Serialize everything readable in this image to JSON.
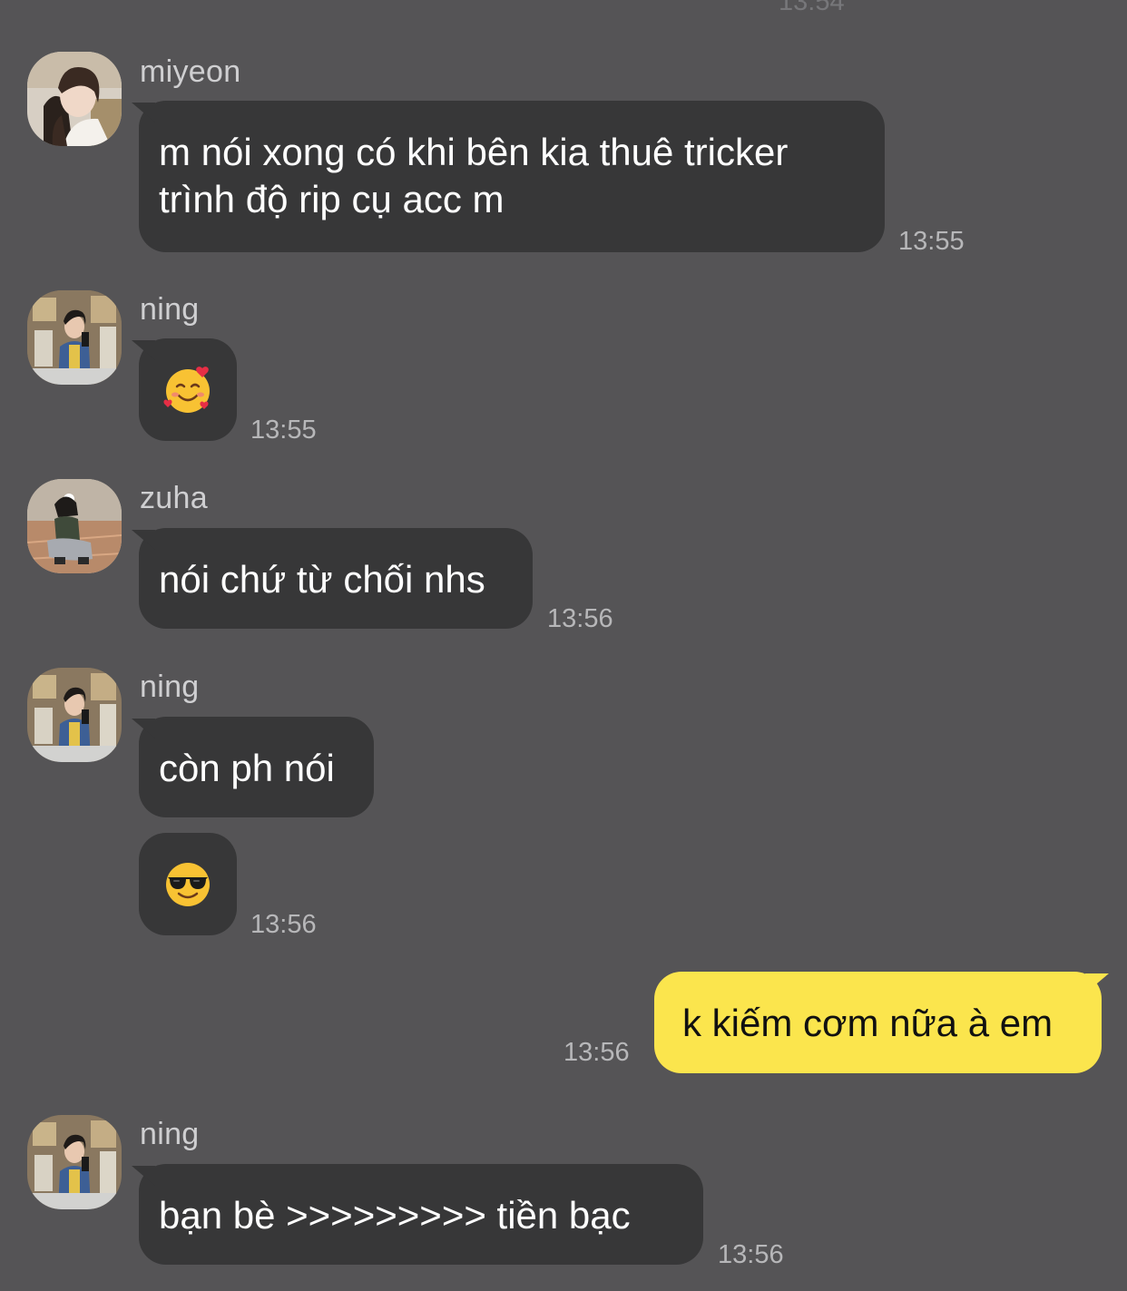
{
  "chat": {
    "top_timestamp": "13:54",
    "messages": [
      {
        "sender": "miyeon",
        "lines": [
          "m nói xong có khi bên kia thuê tricker",
          "trình độ rip cụ acc m"
        ],
        "time": "13:55"
      },
      {
        "sender": "ning",
        "emoji": "smiling-face-with-hearts",
        "time": "13:55"
      },
      {
        "sender": "zuha",
        "text": "nói chứ từ chối nhs",
        "time": "13:56"
      },
      {
        "sender": "ning",
        "text": "còn ph nói"
      },
      {
        "emoji": "smiling-face-with-sunglasses",
        "time": "13:56"
      },
      {
        "sender": "me",
        "text": "k kiếm cơm nữa à em",
        "time": "13:56"
      },
      {
        "sender": "ning",
        "text": "bạn bè >>>>>>>>> tiền bạc",
        "time": "13:56"
      }
    ]
  },
  "colors": {
    "background": "#555456",
    "incoming_bubble": "#373738",
    "outgoing_bubble": "#fbe54d",
    "text_light": "#ffffff",
    "text_dark": "#111111",
    "timestamp": "#b7b7b9"
  }
}
